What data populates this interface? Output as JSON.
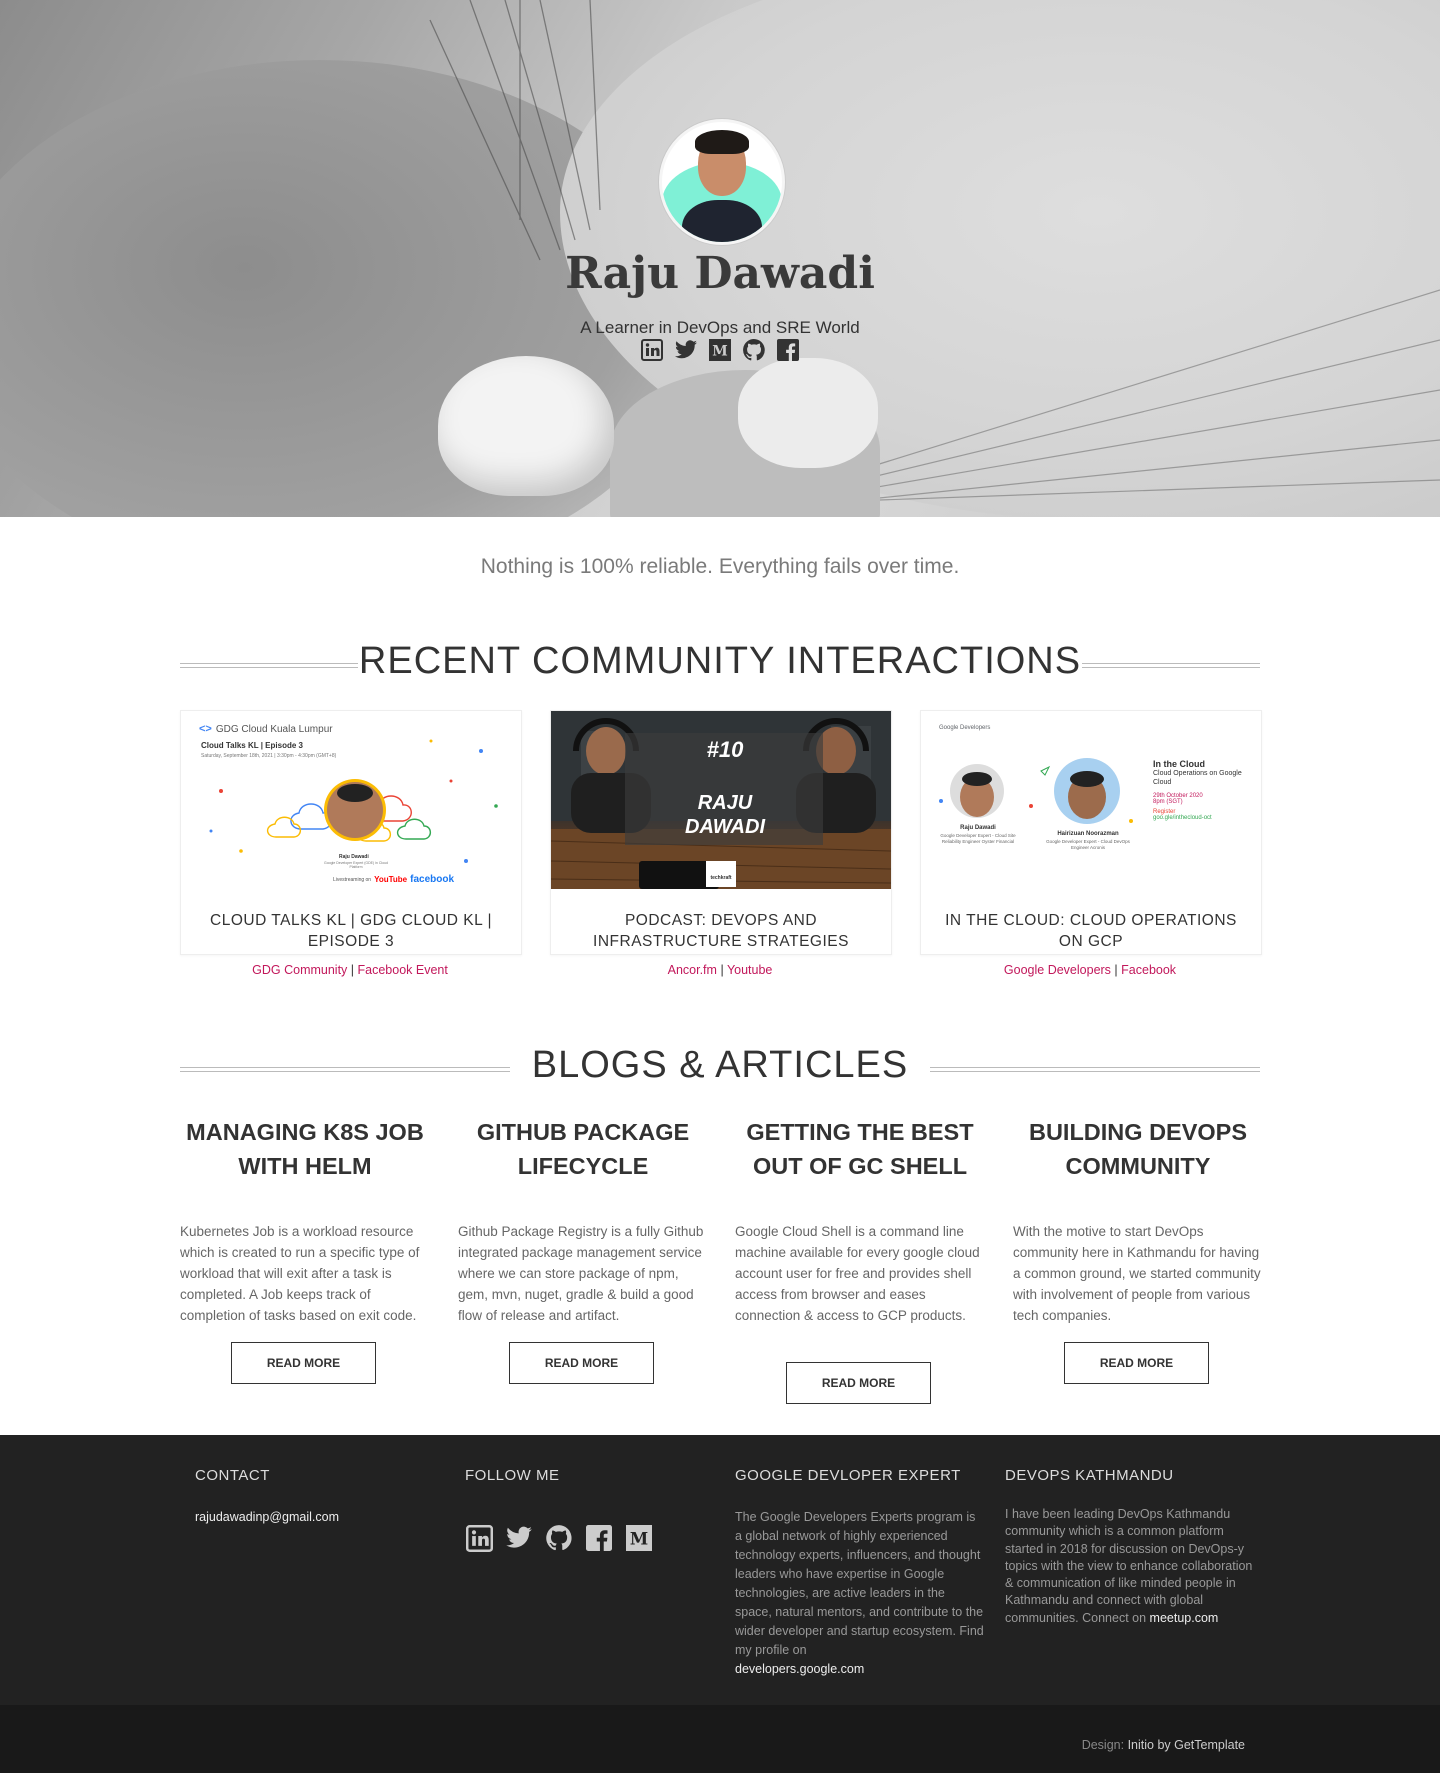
{
  "hero": {
    "name": "Raju Dawadi",
    "tagline": "A Learner in DevOps and SRE World",
    "social": [
      "linkedin-icon",
      "twitter-icon",
      "medium-icon",
      "github-icon",
      "facebook-icon"
    ]
  },
  "quote": "Nothing is 100% reliable. Everything fails over time.",
  "community": {
    "heading": "RECENT COMMUNITY INTERACTIONS",
    "cards": [
      {
        "title": "CLOUD TALKS KL | GDG CLOUD KL | EPISODE 3",
        "thumb": {
          "org": "GDG Cloud Kuala Lumpur",
          "episode": "Cloud Talks KL | Episode 3",
          "date": "Saturday, September 18th, 2021 | 3:30pm - 4:30pm (GMT+8)",
          "person": "Raju Dawadi",
          "role": "Google Developer Expert (GDE) in Cloud Platform",
          "stream": "Livestreaming on",
          "yt": "YouTube",
          "fb": "facebook"
        },
        "links": [
          {
            "label": "GDG Community"
          },
          {
            "label": "Facebook Event"
          }
        ],
        "sep": "|"
      },
      {
        "title": "PODCAST: DEVOPS AND INFRASTRUCTURE STRATEGIES",
        "thumb": {
          "number": "#10",
          "line1": "RAJU",
          "line2": "DAWADI",
          "brand": "techkraft"
        },
        "links": [
          {
            "label": "Ancor.fm"
          },
          {
            "label": "Youtube"
          }
        ],
        "sep": "|"
      },
      {
        "title": "IN THE CLOUD: CLOUD OPERATIONS ON GCP",
        "thumb": {
          "brand": "Google Developers",
          "p1name": "Raju Dawadi",
          "p1role": "Google Developer Expert - Cloud Site Reliability Engineer Oyster Financial",
          "p2name": "Hairizuan Noorazman",
          "p2role": "Google Developer Expert - Cloud DevOps Engineer Acronis",
          "eventTitle": "In the Cloud",
          "eventSub": "Cloud Operations on Google Cloud",
          "date": "29th October 2020",
          "time": "8pm (SGT)",
          "register": "Register",
          "url": "goo.gle/inthecloud-oct"
        },
        "links": [
          {
            "label": "Google Developers"
          },
          {
            "label": "Facebook"
          }
        ],
        "sep": "|"
      }
    ]
  },
  "blogs": {
    "heading": "BLOGS & ARTICLES",
    "items": [
      {
        "title": "MANAGING K8S JOB WITH HELM",
        "text": "Kubernetes Job is a workload resource which is created to run a specific type of workload that will exit after a task is completed. A Job keeps track of completion of tasks based on exit code.",
        "button": "READ MORE"
      },
      {
        "title": "GITHUB PACKAGE LIFECYCLE",
        "text": "Github Package Registry is a fully Github integrated package management service where we can store package of npm, gem, mvn, nuget, gradle & build a good flow of release and artifact.",
        "button": "READ MORE"
      },
      {
        "title": "GETTING THE BEST OUT OF GC SHELL",
        "text": "Google Cloud Shell is a command line machine available for every google cloud account user for free and provides shell access from browser and eases connection & access to GCP products.",
        "button": "READ MORE"
      },
      {
        "title": "BUILDING DEVOPS COMMUNITY",
        "text": "With the motive to start DevOps community here in Kathmandu for having a common ground, we started community with involvement of people from various tech companies.",
        "button": "READ MORE"
      }
    ]
  },
  "footer": {
    "contact": {
      "heading": "CONTACT",
      "email": "rajudawadinp@gmail.com"
    },
    "follow": {
      "heading": "FOLLOW ME",
      "icons": [
        "linkedin-icon",
        "twitter-icon",
        "github-icon",
        "facebook-icon",
        "medium-icon"
      ]
    },
    "gde": {
      "heading": "GOOGLE DEVLOPER EXPERT",
      "text": "The Google Developers Experts program is a global network of highly experienced technology experts, influencers, and thought leaders who have expertise in Google technologies, are active leaders in the space, natural mentors, and contribute to the wider developer and startup ecosystem. Find my profile on",
      "link": "developers.google.com"
    },
    "devops": {
      "heading": "DEVOPS KATHMANDU",
      "text": "I have been leading DevOps Kathmandu community which is a common platform started in 2018 for discussion on DevOps-y topics with the view to enhance collaboration & communication of like minded people in Kathmandu and connect with global communities. Connect on",
      "link": "meetup.com"
    },
    "credit_label": "Design:",
    "credit_link": "Initio by GetTemplate"
  },
  "colors": {
    "accent": "#c2185b",
    "footer_bg": "#222222",
    "subfooter_bg": "#191919"
  }
}
